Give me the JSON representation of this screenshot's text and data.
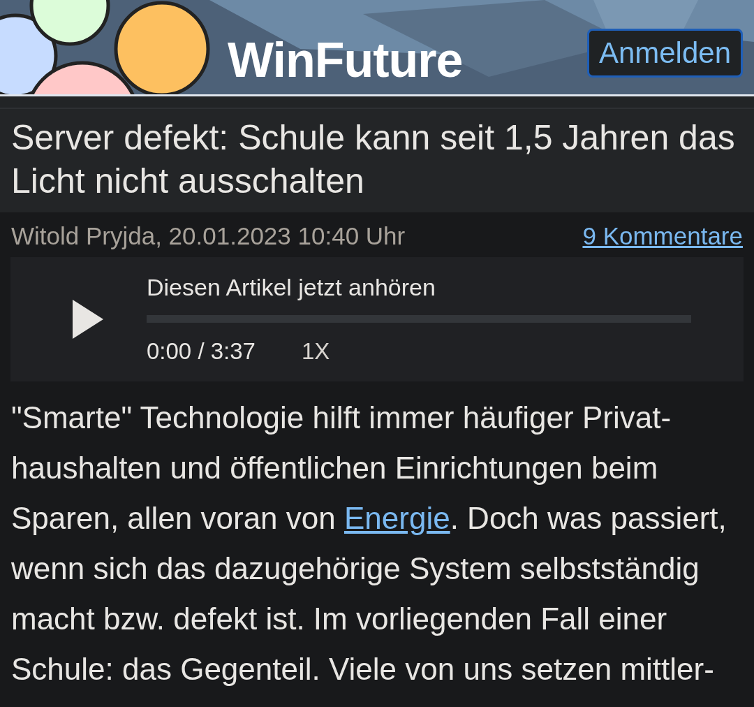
{
  "header": {
    "logo": "WinFuture",
    "login_button": "Anmelden"
  },
  "article": {
    "title": "Server defekt: Schule kann seit 1,5 Jahren das Licht nicht ausschalten",
    "byline": "Witold Pryjda, 20.01.2023 10:40 Uhr",
    "comments_link": "9 Kommentare",
    "audio_player": {
      "label": "Diesen Artikel jetzt anhören",
      "level": 0,
      "time": "0:00 / 3:37",
      "speed": "1X"
    },
    "body_lines": [
      [
        {
          "text": "\"Smarte\" Technologie hilft immer häufiger Privat-"
        }
      ],
      [
        {
          "text": "haushalten und öffentlichen Einrichtungen beim"
        }
      ],
      [
        {
          "text": "Sparen, allen voran von "
        },
        {
          "text": "Energie",
          "kind": "link"
        },
        {
          "text": ". Doch was passiert,"
        }
      ],
      [
        {
          "text": "wenn sich das dazugehörige System selbstständig"
        }
      ],
      [
        {
          "text": "macht bzw. defekt ist. Im vorliegenden Fall einer"
        }
      ],
      [
        {
          "text": "Schule: das Gegenteil. Viele von uns setzen mittler-"
        }
      ]
    ]
  }
}
